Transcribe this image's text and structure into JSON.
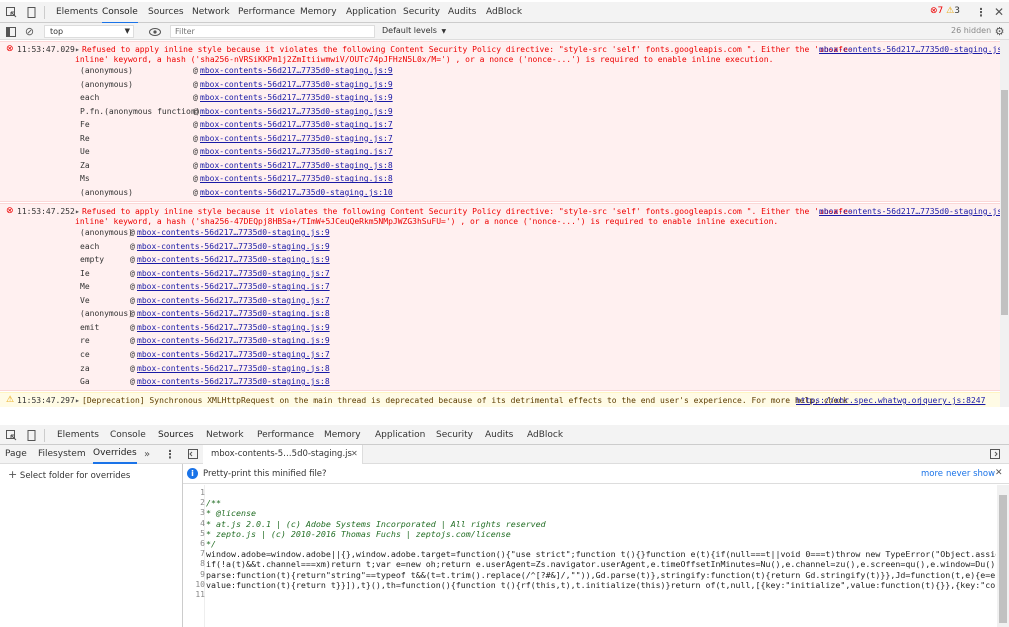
{
  "top_devtools": {
    "tabs": [
      "Elements",
      "Console",
      "Sources",
      "Network",
      "Performance",
      "Memory",
      "Application",
      "Security",
      "Audits",
      "AdBlock"
    ],
    "active_tab": "Console",
    "error_count": "7",
    "warning_count": "3"
  },
  "console_toolbar": {
    "context": "top",
    "filter_placeholder": "Filter",
    "levels": "Default levels",
    "hidden": "26 hidden"
  },
  "messages": {
    "err1": {
      "time": "11:53:47.029",
      "line1": "Refused to apply inline style because it violates the following Content Security Policy directive: \"style-src 'self' fonts.googleapis.com \". Either the 'unsafe-",
      "line2": "inline' keyword, a hash ('sha256-nVRSiKKPm1j2ZmItiiwmwiV/OUTc74pJFHzN5L0x/M=') , or a nonce ('nonce-...') is required to enable inline execution.",
      "source": "mbox-contents-56d217…7735d0-staging.js:9",
      "trace": [
        {
          "fn": "(anonymous)",
          "src": "mbox-contents-56d217…7735d0-staging.js:9"
        },
        {
          "fn": "(anonymous)",
          "src": "mbox-contents-56d217…7735d0-staging.js:9"
        },
        {
          "fn": "each",
          "src": "mbox-contents-56d217…7735d0-staging.js:9"
        },
        {
          "fn": "P.fn.(anonymous function)",
          "src": "mbox-contents-56d217…7735d0-staging.js:9"
        },
        {
          "fn": "Fe",
          "src": "mbox-contents-56d217…7735d0-staging.js:7"
        },
        {
          "fn": "Re",
          "src": "mbox-contents-56d217…7735d0-staging.js:7"
        },
        {
          "fn": "Ue",
          "src": "mbox-contents-56d217…7735d0-staging.js:7"
        },
        {
          "fn": "Za",
          "src": "mbox-contents-56d217…7735d0-staging.js:8"
        },
        {
          "fn": "Ms",
          "src": "mbox-contents-56d217…7735d0-staging.js:8"
        },
        {
          "fn": "(anonymous)",
          "src": "mbox-contents-56d217…735d0-staging.js:10"
        }
      ]
    },
    "err2": {
      "time": "11:53:47.252",
      "line1": "Refused to apply inline style because it violates the following Content Security Policy directive: \"style-src 'self' fonts.googleapis.com \". Either the 'unsafe-",
      "line2": "inline' keyword, a hash ('sha256-47DEQpj8HBSa+/TImW+5JCeuQeRkm5NMpJWZG3hSuFU=') , or a nonce ('nonce-...') is required to enable inline execution.",
      "source": "mbox-contents-56d217…7735d0-staging.js:9",
      "trace": [
        {
          "fn": "(anonymous)",
          "src": "mbox-contents-56d217…7735d0-staging.js:9"
        },
        {
          "fn": "each",
          "src": "mbox-contents-56d217…7735d0-staging.js:9"
        },
        {
          "fn": "empty",
          "src": "mbox-contents-56d217…7735d0-staging.js:9"
        },
        {
          "fn": "Ie",
          "src": "mbox-contents-56d217…7735d0-staging.js:7"
        },
        {
          "fn": "Me",
          "src": "mbox-contents-56d217…7735d0-staging.js:7"
        },
        {
          "fn": "Ve",
          "src": "mbox-contents-56d217…7735d0-staging.js:7"
        },
        {
          "fn": "(anonymous)",
          "src": "mbox-contents-56d217…7735d0-staging.js:8"
        },
        {
          "fn": "emit",
          "src": "mbox-contents-56d217…7735d0-staging.js:9"
        },
        {
          "fn": "re",
          "src": "mbox-contents-56d217…7735d0-staging.js:9"
        },
        {
          "fn": "ce",
          "src": "mbox-contents-56d217…7735d0-staging.js:7"
        },
        {
          "fn": "za",
          "src": "mbox-contents-56d217…7735d0-staging.js:8"
        },
        {
          "fn": "Ga",
          "src": "mbox-contents-56d217…7735d0-staging.js:8"
        }
      ]
    },
    "warn": {
      "time": "11:53:47.297",
      "text": "[Deprecation] Synchronous XMLHttpRequest on the main thread is deprecated because of its detrimental effects to the end user's experience. For more help, check",
      "link": "https://xhr.spec.whatwg.or",
      "source": "jquery.js:8247"
    }
  },
  "bottom_devtools": {
    "tabs": [
      "Elements",
      "Console",
      "Sources",
      "Network",
      "Performance",
      "Memory",
      "Application",
      "Security",
      "Audits",
      "AdBlock"
    ],
    "active_tab": "Sources",
    "nav_tabs": [
      "Page",
      "Filesystem",
      "Overrides"
    ],
    "active_nav": "Overrides",
    "select_folder": "Select folder for overrides",
    "file_tab": "mbox-contents-5…5d0-staging.js",
    "pretty_print_msg": "Pretty-print this minified file?",
    "more": "more",
    "never_show": "never show"
  },
  "code": {
    "line_numbers": [
      "1",
      "2",
      "3",
      "4",
      "5",
      "6",
      "7",
      "8",
      "9",
      "10",
      "11"
    ],
    "lines": [
      "",
      "/**",
      " * @license",
      " * at.js 2.0.1 | (c) Adobe Systems Incorporated | All rights reserved",
      " * zepto.js | (c) 2010-2016 Thomas Fuchs | zeptojs.com/license",
      " */",
      "window.adobe=window.adobe||{},window.adobe.target=function(){\"use strict\";function t(){}function e(t){if(null===t||void 0===t)throw new TypeError(\"Object.assign",
      "if(!a(t)&&t.channel===xm)return t;var e=new oh;return e.userAgent=Zs.navigator.userAgent,e.timeOffsetInMinutes=Nu(),e.channel=zu(),e.screen=qu(),e.window=Du(),e.",
      "parse:function(t){return\"string\"==typeof t&&(t=t.trim().replace(/^[?#&]/,\"\")),Gd.parse(t)},stringify:function(t){return Gd.stringify(t)}},Jd=function(t,e){e=e||{",
      "value:function(t){return t}}]),t}(),th=function(){function t(){rf(this,t),t.initialize(this)}return of(t,null,[{key:\"initialize\",value:function(t){}},{key:\"const",
      ""
    ]
  },
  "colors": {
    "error_bg": "#fff0f0",
    "error_text": "#ff0000",
    "warning_bg": "#fffbe5",
    "link": "#1a1aa6",
    "active_tab": "#1a73e8"
  }
}
